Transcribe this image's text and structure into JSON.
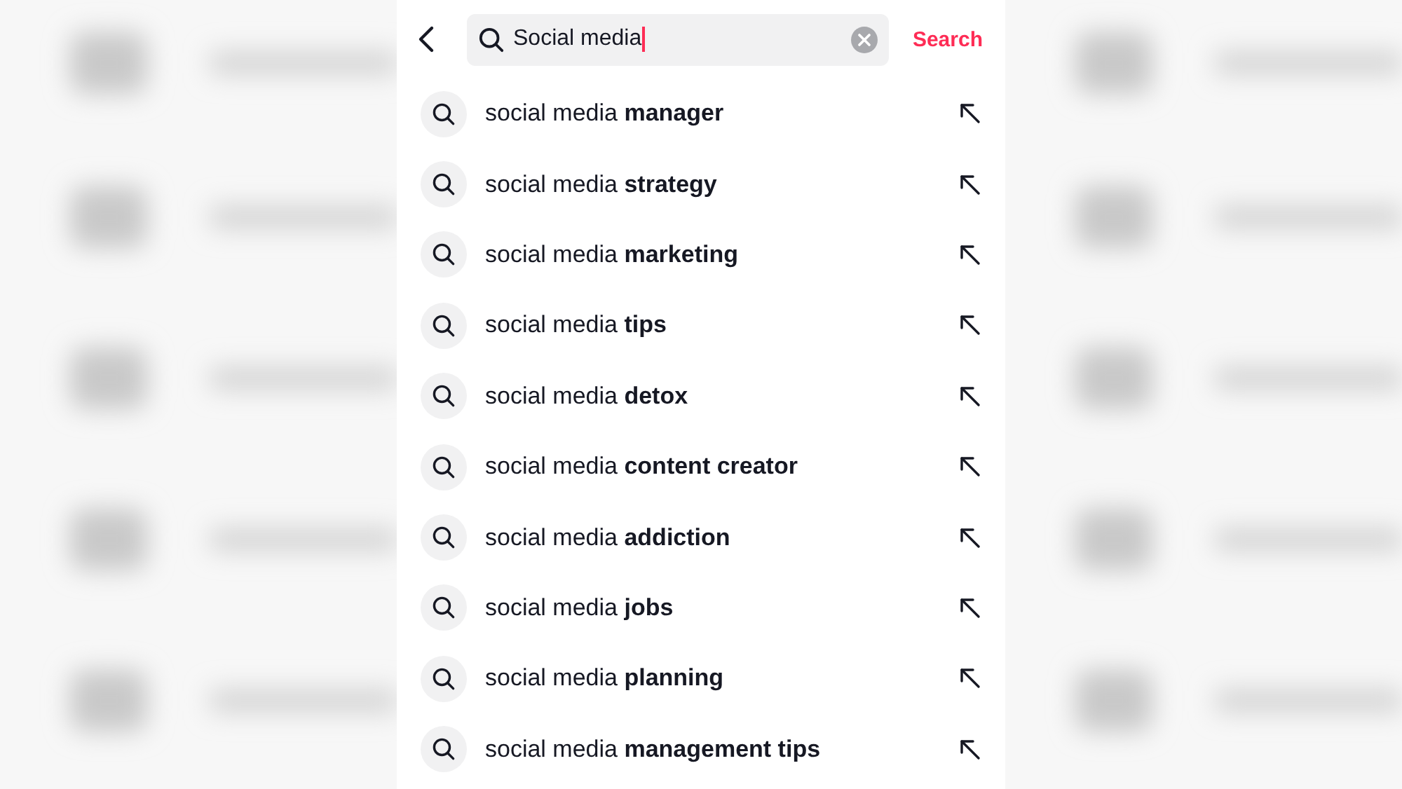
{
  "search_bar": {
    "value": "Social media",
    "submit_label": "Search"
  },
  "suggestions": [
    {
      "text": "social media **manager**"
    },
    {
      "text": "social media **strategy**"
    },
    {
      "text": "social media **marketing**"
    },
    {
      "text": "social media **tips**"
    },
    {
      "text": "social media **detox**"
    },
    {
      "text": "social media **content creator**"
    },
    {
      "text": "social media **addiction**"
    },
    {
      "text": "social media **jobs**"
    },
    {
      "text": "social media **planning**"
    },
    {
      "text": "social media **management tips**"
    }
  ]
}
